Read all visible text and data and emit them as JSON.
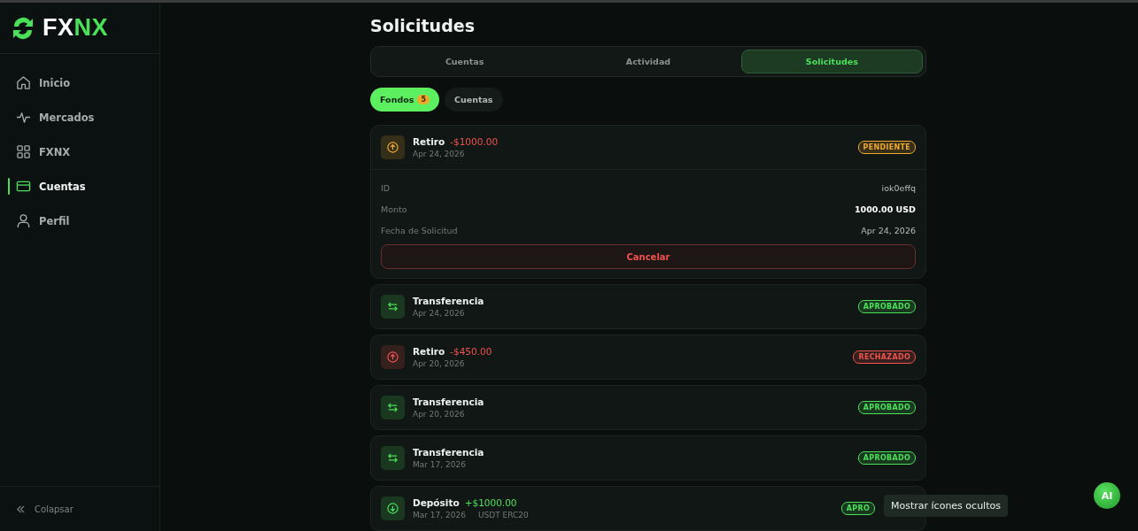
{
  "brand": {
    "name_white": "FX",
    "name_green": "NX"
  },
  "sidebar": {
    "items": [
      {
        "label": "Inicio",
        "selected": false
      },
      {
        "label": "Mercados",
        "selected": false
      },
      {
        "label": "FXNX",
        "selected": false
      },
      {
        "label": "Cuentas",
        "selected": true
      },
      {
        "label": "Perfil",
        "selected": false
      }
    ],
    "collapse": "Colapsar"
  },
  "page_title": "Solicitudes",
  "tabs": [
    {
      "label": "Cuentas",
      "selected": false
    },
    {
      "label": "Actividad",
      "selected": false
    },
    {
      "label": "Solicitudes",
      "selected": true
    }
  ],
  "filters": [
    {
      "label": "Fondos",
      "count": "5",
      "selected": true
    },
    {
      "label": "Cuentas",
      "selected": false
    }
  ],
  "requests": [
    {
      "kind": "withdrawal",
      "title": "Retiro",
      "amount": "-$1000.00",
      "date": "Apr 24, 2026",
      "color": "#f0a92b",
      "status_label": "PENDIENTE",
      "expanded": true,
      "details": [
        {
          "label": "ID",
          "value": "iok0effq",
          "strong": false
        },
        {
          "label": "Monto",
          "value": "1000.00 USD",
          "strong": true
        },
        {
          "label": "Fecha de Solicitud",
          "value": "Apr 24, 2026",
          "strong": false
        }
      ],
      "action": "Cancelar"
    },
    {
      "kind": "transfer",
      "title": "Transferencia",
      "date": "Apr 24, 2026",
      "color": "#4be05a",
      "status_label": "APROBADO",
      "expanded": false
    },
    {
      "kind": "withdrawal",
      "title": "Retiro",
      "amount": "-$450.00",
      "date": "Apr 20, 2026",
      "color": "#f0524f",
      "status_label": "RECHAZADO",
      "expanded": false
    },
    {
      "kind": "transfer",
      "title": "Transferencia",
      "date": "Apr 20, 2026",
      "color": "#4be05a",
      "status_label": "APROBADO",
      "expanded": false
    },
    {
      "kind": "transfer",
      "title": "Transferencia",
      "date": "Mar 17, 2026",
      "color": "#4be05a",
      "status_label": "APROBADO",
      "expanded": false
    },
    {
      "kind": "deposit",
      "title": "Depósito",
      "amount": "+$1000.00",
      "date": "Mar 17, 2026",
      "network": "USDT ERC20",
      "color": "#4be05a",
      "status_label": "APRO",
      "expanded": false
    }
  ],
  "tooltip": "Mostrar ícones ocultos",
  "ai_button": "AI"
}
